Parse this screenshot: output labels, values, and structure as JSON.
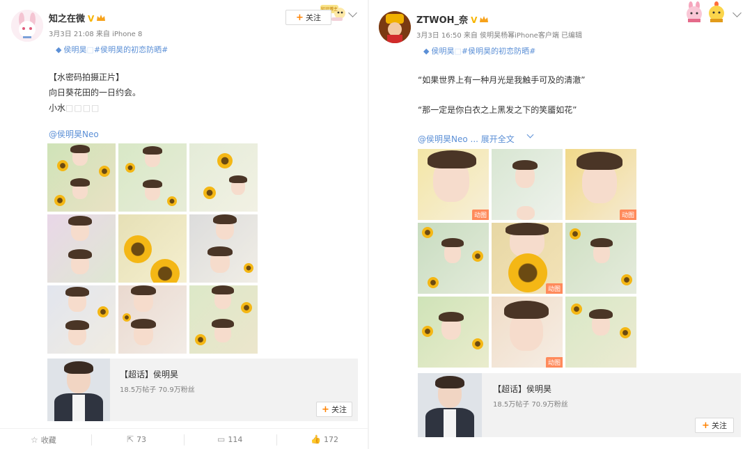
{
  "left_post": {
    "user_name": "知之在微",
    "meta": "3月3日 21:08 来自 iPhone 8",
    "topic_prefix": "侯明昊",
    "topic_faded": "□",
    "topic_tag": "#侯明昊的初恋防晒#",
    "follow_label": "关注",
    "badge_text": "知识博主",
    "lines": [
      "【水密码拍摄正片】",
      "向日葵花田的一日约会。"
    ],
    "line3_text": "小水",
    "line3_faded": "□□□□",
    "mention": "@侯明昊Neo",
    "card": {
      "title": "【超话】侯明昊",
      "stats": "18.5万帖子 70.9万粉丝",
      "follow_label": "关注"
    },
    "actions": {
      "favorite": "收藏",
      "repost": "73",
      "comment": "114",
      "like": "172"
    }
  },
  "right_post": {
    "user_name": "ZTWOH_奈",
    "meta": "3月3日 16:50 来自 侯明昊杨幂iPhone客户端  已编辑",
    "topic_prefix": "侯明昊",
    "topic_faded": "□",
    "topic_tag": "#侯明昊的初恋防晒#",
    "lines": [
      "“如果世界上有一种月光是我触手可及的清澈”",
      "“那一定是你白衣之上黑发之下的笑靥如花”"
    ],
    "mention": "@侯明昊Neo",
    "expand_label": "展开全文",
    "gif_label": "动图",
    "card": {
      "title": "【超话】侯明昊",
      "stats": "18.5万帖子 70.9万粉丝",
      "follow_label": "关注"
    }
  },
  "icons": {
    "verified": "verified-v-icon",
    "crown": "crown-icon",
    "topic": "diamond-icon",
    "more": "chevron-down-icon",
    "plus": "plus-icon",
    "star": "star-icon",
    "repost": "repost-icon",
    "comment": "comment-icon",
    "like": "thumbs-up-icon"
  },
  "colors": {
    "link": "#5b8fd6",
    "accent": "#ff8200",
    "verified": "#f7b500",
    "gif_badge": "#ff8a5b"
  }
}
